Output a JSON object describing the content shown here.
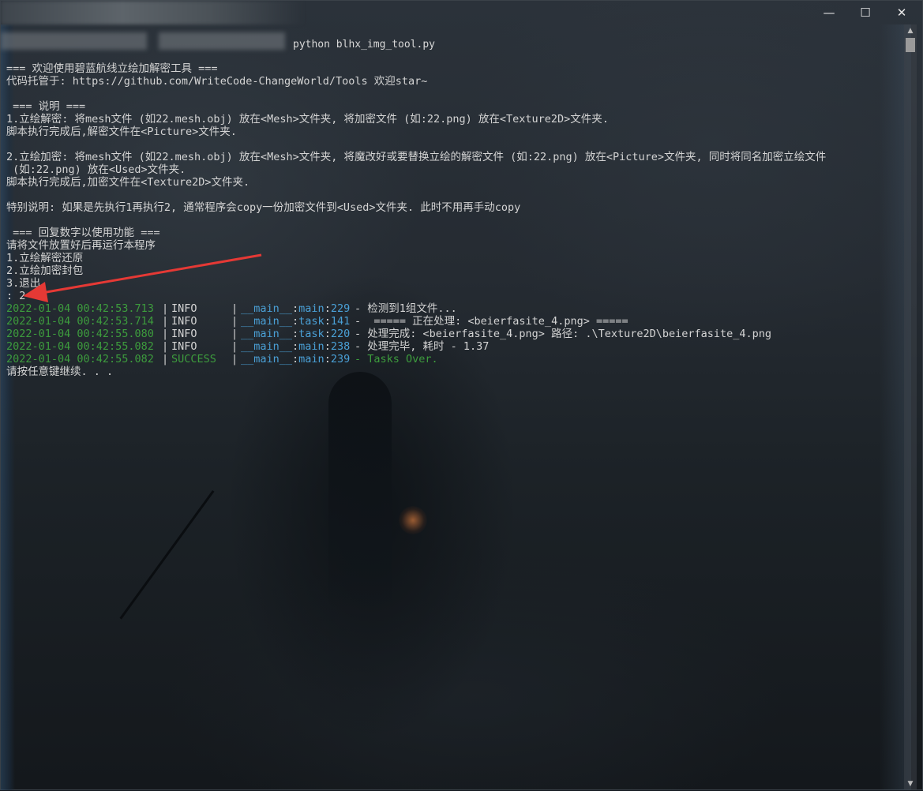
{
  "window": {
    "title": "python blhx_img_tool.py",
    "controls": {
      "minimize": "—",
      "maximize": "☐",
      "close": "✕"
    }
  },
  "console": {
    "intro": [
      "=== 欢迎使用碧蓝航线立绘加解密工具 ===",
      "代码托管于: https://github.com/WriteCode-ChangeWorld/Tools 欢迎star~",
      "",
      " === 说明 ===",
      "1.立绘解密: 将mesh文件 (如22.mesh.obj) 放在<Mesh>文件夹, 将加密文件 (如:22.png) 放在<Texture2D>文件夹.",
      "脚本执行完成后,解密文件在<Picture>文件夹.",
      "",
      "2.立绘加密: 将mesh文件 (如22.mesh.obj) 放在<Mesh>文件夹, 将魔改好或要替换立绘的解密文件 (如:22.png) 放在<Picture>文件夹, 同时将同名加密立绘文件",
      " (如:22.png) 放在<Used>文件夹.",
      "脚本执行完成后,加密文件在<Texture2D>文件夹.",
      "",
      "特别说明: 如果是先执行1再执行2, 通常程序会copy一份加密文件到<Used>文件夹. 此时不用再手动copy",
      "",
      " === 回复数字以使用功能 ===",
      "请将文件放置好后再运行本程序",
      "1.立绘解密还原",
      "2.立绘加密封包",
      "3.退出",
      ": 2"
    ],
    "logs": [
      {
        "time": "2022-01-04 00:42:53.713",
        "level": "INFO",
        "module": "__main__",
        "func": "main",
        "line": "229",
        "message": "- 检测到1组文件..."
      },
      {
        "time": "2022-01-04 00:42:53.714",
        "level": "INFO",
        "module": "__main__",
        "func": "task",
        "line": "141",
        "message": "-  ===== 正在处理: <beierfasite_4.png> ====="
      },
      {
        "time": "2022-01-04 00:42:55.080",
        "level": "INFO",
        "module": "__main__",
        "func": "task",
        "line": "220",
        "message": "- 处理完成: <beierfasite_4.png> 路径: .\\Texture2D\\beierfasite_4.png"
      },
      {
        "time": "2022-01-04 00:42:55.082",
        "level": "INFO",
        "module": "__main__",
        "func": "main",
        "line": "238",
        "message": "- 处理完毕, 耗时 - 1.37"
      },
      {
        "time": "2022-01-04 00:42:55.082",
        "level": "SUCCESS",
        "module": "__main__",
        "func": "main",
        "line": "239",
        "message": "- Tasks Over."
      }
    ],
    "footer": "请按任意键继续. . ."
  },
  "colors": {
    "timestamp": "#3d9c3d",
    "module": "#4aa0d6",
    "success": "#3d9c3d",
    "text": "#d4d4d4",
    "arrow": "#e53935"
  }
}
